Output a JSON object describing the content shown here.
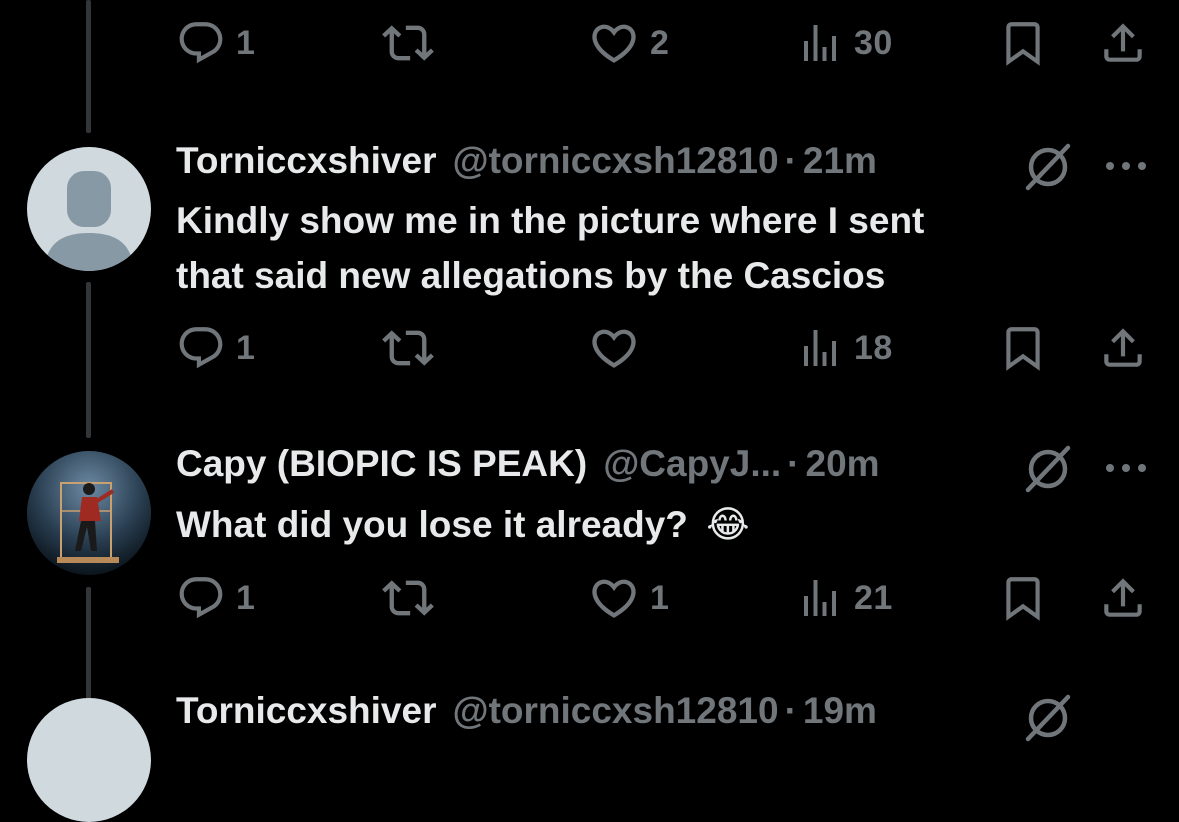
{
  "app": "X",
  "posts": [
    {
      "stats": {
        "replies": "1",
        "reposts": "",
        "likes": "2",
        "views": "30"
      }
    },
    {
      "author_name": "Torniccxshiver",
      "handle": "@torniccxsh12810",
      "separator": "·",
      "time": "21m",
      "text_lines": [
        "Kindly show me in the picture where I sent",
        "that said new allegations by the Cascios"
      ],
      "avatar": "default-avatar",
      "stats": {
        "replies": "1",
        "reposts": "",
        "likes": "",
        "views": "18"
      }
    },
    {
      "author_name": "Capy (BIOPIC IS PEAK)",
      "handle": "@CapyJ...",
      "separator": "·",
      "time": "20m",
      "text_lines": [
        "What did you lose it already?"
      ],
      "emoji": "😂",
      "avatar": "performer-photo-avatar",
      "stats": {
        "replies": "1",
        "reposts": "",
        "likes": "1",
        "views": "21"
      }
    },
    {
      "author_name": "Torniccxshiver",
      "handle": "@torniccxsh12810",
      "separator": "·",
      "time": "19m"
    }
  ],
  "icons": {
    "reply": "reply-icon",
    "repost": "repost-icon",
    "like": "heart-icon",
    "views": "views-icon",
    "bookmark": "bookmark-icon",
    "share": "share-icon",
    "grok": "grok-icon",
    "more": "more-icon"
  },
  "colors": {
    "background": "#000000",
    "text": "#e7e9ea",
    "muted": "#71767b",
    "thread_line": "#333639",
    "avatar_default": "#cfd9de",
    "avatar_figure": "#8899a6"
  }
}
